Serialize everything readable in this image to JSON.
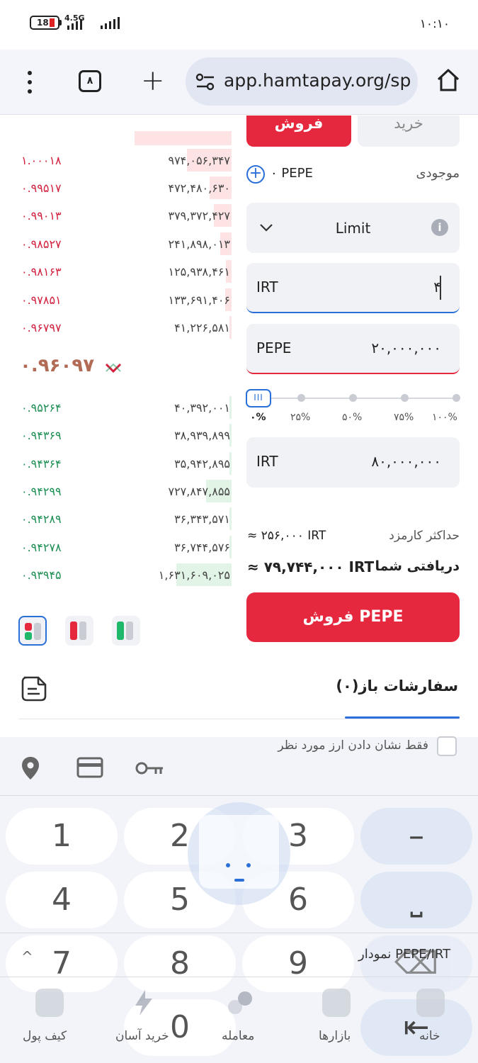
{
  "status": {
    "battery": "18",
    "network": "4.5G",
    "time": "۱۰:۱۰"
  },
  "browser": {
    "tab_count": "۸",
    "url": "app.hamtapay.org/sp"
  },
  "trade_tabs": {
    "sell": "فروش",
    "buy": "خرید"
  },
  "balance": {
    "label": "موجودی",
    "value": "۰ PEPE"
  },
  "order_type": {
    "selected": "Limit"
  },
  "price_field": {
    "currency": "IRT",
    "value": "۴"
  },
  "amount_field": {
    "currency": "PEPE",
    "value": "۲۰,۰۰۰,۰۰۰"
  },
  "slider": {
    "labels": [
      "۰%",
      "۲۵%",
      "۵۰%",
      "۷۵%",
      "۱۰۰%"
    ],
    "value_percent": 0
  },
  "total_field": {
    "currency": "IRT",
    "value": "۸۰,۰۰۰,۰۰۰"
  },
  "fee": {
    "label": "حداکثر کارمزد",
    "value": "≈ ۲۵۶,۰۰۰ IRT"
  },
  "receive": {
    "label": "دریافتی شما",
    "value": "≈ ۷۹,۷۴۴,۰۰۰ IRT"
  },
  "submit": {
    "label": "فروش PEPE"
  },
  "orderbook": {
    "asks": [
      {
        "price": "۱.۰۰۰۱۸",
        "amount": "۹۷۴,۰۵۶,۳۴۷"
      },
      {
        "price": "۰.۹۹۵۱۷",
        "amount": "۴۷۲,۴۸۰,۶۳۰"
      },
      {
        "price": "۰.۹۹۰۱۳",
        "amount": "۳۷۹,۳۷۲,۴۲۷"
      },
      {
        "price": "۰.۹۸۵۲۷",
        "amount": "۲۴۱,۸۹۸,۰۱۳"
      },
      {
        "price": "۰.۹۸۱۶۳",
        "amount": "۱۲۵,۹۳۸,۴۶۱"
      },
      {
        "price": "۰.۹۷۸۵۱",
        "amount": "۱۳۳,۶۹۱,۴۰۶"
      },
      {
        "price": "۰.۹۶۷۹۷",
        "amount": "۴۱,۲۲۶,۵۸۱"
      }
    ],
    "mid_price": "۰.۹۶۰۹۷",
    "bids": [
      {
        "price": "۰.۹۵۲۶۴",
        "amount": "۴۰,۳۹۲,۰۰۱"
      },
      {
        "price": "۰.۹۴۳۶۹",
        "amount": "۳۸,۹۳۹,۸۹۹"
      },
      {
        "price": "۰.۹۴۳۶۴",
        "amount": "۳۵,۹۴۲,۸۹۵"
      },
      {
        "price": "۰.۹۴۲۹۹",
        "amount": "۷۲۷,۸۴۷,۸۵۵"
      },
      {
        "price": "۰.۹۴۲۸۹",
        "amount": "۳۶,۳۴۳,۵۷۱"
      },
      {
        "price": "۰.۹۴۲۷۸",
        "amount": "۳۶,۷۴۴,۵۷۶"
      },
      {
        "price": "۰.۹۳۹۴۵",
        "amount": "۱,۶۳۱,۶۰۹,۰۲۵"
      }
    ]
  },
  "open_orders": {
    "title": "سفارشات باز(۰)",
    "filter": "فقط نشان دادن ارز مورد نظر"
  },
  "keyboard": {
    "keys": [
      "1",
      "2",
      "3",
      "–",
      "4",
      "5",
      "6",
      "⎵",
      "7",
      "8",
      "9",
      "⌫",
      "0"
    ]
  },
  "chart_link": "نمودار PEPE/IRT",
  "bottom_nav": [
    "کیف پول",
    "خرید آسان",
    "معامله",
    "بازارها",
    "خانه"
  ]
}
